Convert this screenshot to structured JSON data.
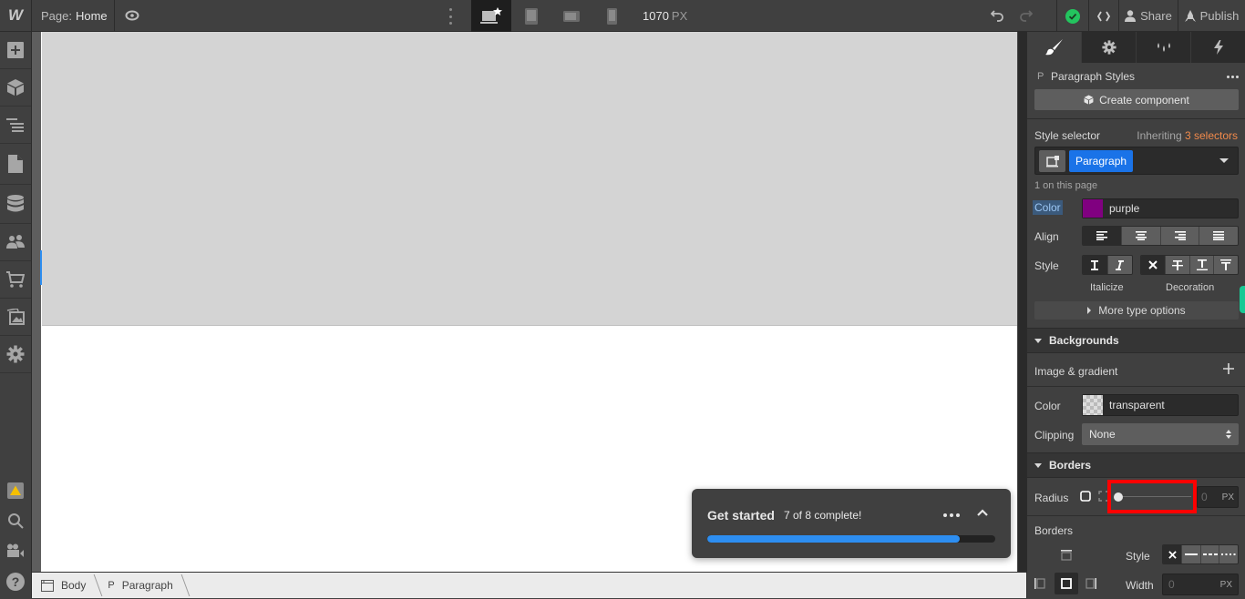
{
  "topbar": {
    "logo": "W",
    "page_prefix": "Page:",
    "page_name": "Home",
    "canvas_width_value": "1070",
    "canvas_width_unit": "PX",
    "share_label": "Share",
    "publish_label": "Publish",
    "devices": [
      "desktop-base",
      "tablet",
      "mobile-landscape",
      "mobile-portrait"
    ],
    "active_device": "desktop-base",
    "status": "saved"
  },
  "leftbar": {
    "items": [
      "add-elements",
      "components",
      "navigator",
      "pages",
      "cms",
      "users",
      "ecommerce",
      "assets",
      "settings"
    ],
    "bottom_items": [
      "audit-warning",
      "search",
      "video-tutorials",
      "help"
    ]
  },
  "canvas": {
    "hero_color": "#d4d4d4",
    "selection_color": "#2e8ef0"
  },
  "get_started": {
    "title": "Get started",
    "count_text": "7 of 8 complete!",
    "completed": 7,
    "total": 8,
    "progress_fraction": 0.875,
    "bar_color": "#2d8ef1"
  },
  "breadcrumb": [
    {
      "tag": "",
      "label": "Body",
      "icon": "body-icon"
    },
    {
      "tag": "P",
      "label": "Paragraph",
      "icon": "paragraph-icon"
    }
  ],
  "panel": {
    "tabs": [
      "style",
      "settings",
      "interactions-drops",
      "interactions"
    ],
    "active_tab": "style",
    "element_tag": "P",
    "element_title": "Paragraph Styles",
    "create_component_label": "Create component",
    "style_selector_label": "Style selector",
    "inheriting_prefix": "Inheriting",
    "inheriting_count_label": "3 selectors",
    "inheriting_color": "#f28a4b",
    "selector_chip": "Paragraph",
    "on_page_text": "1 on this page",
    "typography": {
      "color_label": "Color",
      "color_value": "purple",
      "color_hex": "#800080",
      "align_label": "Align",
      "align_options": [
        "left",
        "center",
        "right",
        "justify"
      ],
      "align_selected": "left",
      "style_label": "Style",
      "italicize_label": "Italicize",
      "decoration_label": "Decoration",
      "italic_options": [
        "regular",
        "italic"
      ],
      "italic_selected": "regular",
      "decoration_options": [
        "none",
        "strikethrough",
        "underline",
        "overline"
      ],
      "decoration_selected": "none",
      "more_type_label": "More type options"
    },
    "backgrounds": {
      "heading": "Backgrounds",
      "image_gradient_label": "Image & gradient",
      "color_label": "Color",
      "color_value": "transparent",
      "clipping_label": "Clipping",
      "clipping_value": "None"
    },
    "borders": {
      "heading": "Borders",
      "radius_label": "Radius",
      "radius_value": "0",
      "radius_unit": "PX",
      "radius_slider_fraction": 0,
      "borders_label": "Borders",
      "style_label": "Style",
      "style_options": [
        "none",
        "solid",
        "dashed",
        "dotted"
      ],
      "style_selected": "none",
      "width_label": "Width",
      "width_placeholder": "0",
      "width_unit": "PX"
    }
  },
  "highlight_color": "#ff0000"
}
